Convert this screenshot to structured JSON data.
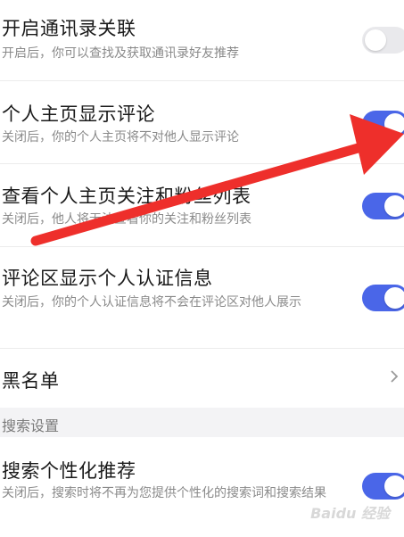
{
  "settings": [
    {
      "title": "开启通讯录关联",
      "desc": "开启后，你可以查找及获取通讯录好友推荐",
      "toggle": "off"
    },
    {
      "title": "个人主页显示评论",
      "desc": "关闭后，你的个人主页将不对他人显示评论",
      "toggle": "on"
    },
    {
      "title": "查看个人主页关注和粉丝列表",
      "desc": "关闭后，他人将无法查看你的关注和粉丝列表",
      "toggle": "on"
    },
    {
      "title": "评论区显示个人认证信息",
      "desc": "关闭后，你的个人认证信息将不会在评论区对他人展示",
      "toggle": "on"
    }
  ],
  "blacklist": {
    "title": "黑名单"
  },
  "search_section": {
    "header": "搜索设置",
    "item": {
      "title": "搜索个性化推荐",
      "desc": "关闭后，搜索时将不再为您提供个性化的搜索词和搜索结果",
      "toggle": "on"
    }
  },
  "watermark": "Baidu 经验",
  "colors": {
    "toggle_on": "#4a66e8",
    "toggle_off": "#e9e9ec",
    "arrow": "#ee2f2b"
  }
}
